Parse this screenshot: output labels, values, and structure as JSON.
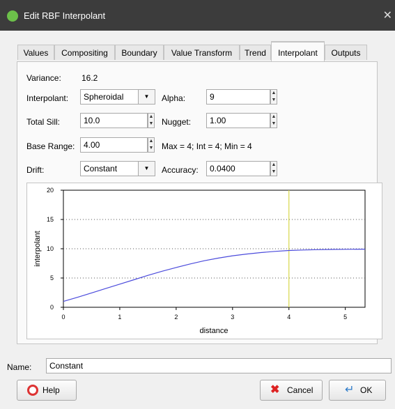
{
  "window": {
    "title": "Edit RBF Interpolant",
    "close_glyph": "✕"
  },
  "tabs": [
    {
      "label": "Values"
    },
    {
      "label": "Compositing"
    },
    {
      "label": "Boundary"
    },
    {
      "label": "Value Transform"
    },
    {
      "label": "Trend"
    },
    {
      "label": "Interpolant",
      "active": true
    },
    {
      "label": "Outputs"
    }
  ],
  "form": {
    "variance_label": "Variance:",
    "variance_value": "16.2",
    "interpolant_label": "Interpolant:",
    "interpolant_value": "Spheroidal",
    "alpha_label": "Alpha:",
    "alpha_value": "9",
    "total_sill_label": "Total Sill:",
    "total_sill_value": "10.0",
    "nugget_label": "Nugget:",
    "nugget_value": "1.00",
    "base_range_label": "Base Range:",
    "base_range_value": "4.00",
    "range_summary": "Max = 4; Int = 4; Min = 4",
    "drift_label": "Drift:",
    "drift_value": "Constant",
    "accuracy_label": "Accuracy:",
    "accuracy_value": "0.0400"
  },
  "chart_data": {
    "type": "line",
    "xlabel": "distance",
    "ylabel": "interpolant",
    "xlim": [
      0,
      5.35
    ],
    "ylim": [
      0,
      20
    ],
    "xticks": [
      "0",
      "1",
      "2",
      "3",
      "4",
      "5"
    ],
    "yticks": [
      "0",
      "5",
      "10",
      "15",
      "20"
    ],
    "grid": "horizontal dotted",
    "series": [
      {
        "color": "#4b4bdc",
        "x": [
          0,
          0.25,
          0.5,
          0.75,
          1.0,
          1.25,
          1.5,
          1.75,
          2.0,
          2.25,
          2.5,
          2.75,
          3.0,
          3.25,
          3.5,
          3.75,
          4.0,
          4.25,
          4.5,
          4.75,
          5.0,
          5.35
        ],
        "y": [
          1.0,
          1.7,
          2.45,
          3.2,
          3.95,
          4.7,
          5.45,
          6.15,
          6.8,
          7.4,
          7.95,
          8.4,
          8.8,
          9.1,
          9.35,
          9.55,
          9.7,
          9.78,
          9.84,
          9.88,
          9.91,
          9.93
        ]
      }
    ],
    "marker_line": {
      "x": 4,
      "color": "#d8d84a"
    }
  },
  "name_field": {
    "label": "Name:",
    "value": "Constant"
  },
  "buttons": {
    "help": "Help",
    "cancel": "Cancel",
    "ok": "OK"
  },
  "colors": {
    "titlebar": "#3c3c3c",
    "active_tab_accent": "#f0a030",
    "curve": "#4b4bdc",
    "marker_line": "#d8d84a"
  }
}
